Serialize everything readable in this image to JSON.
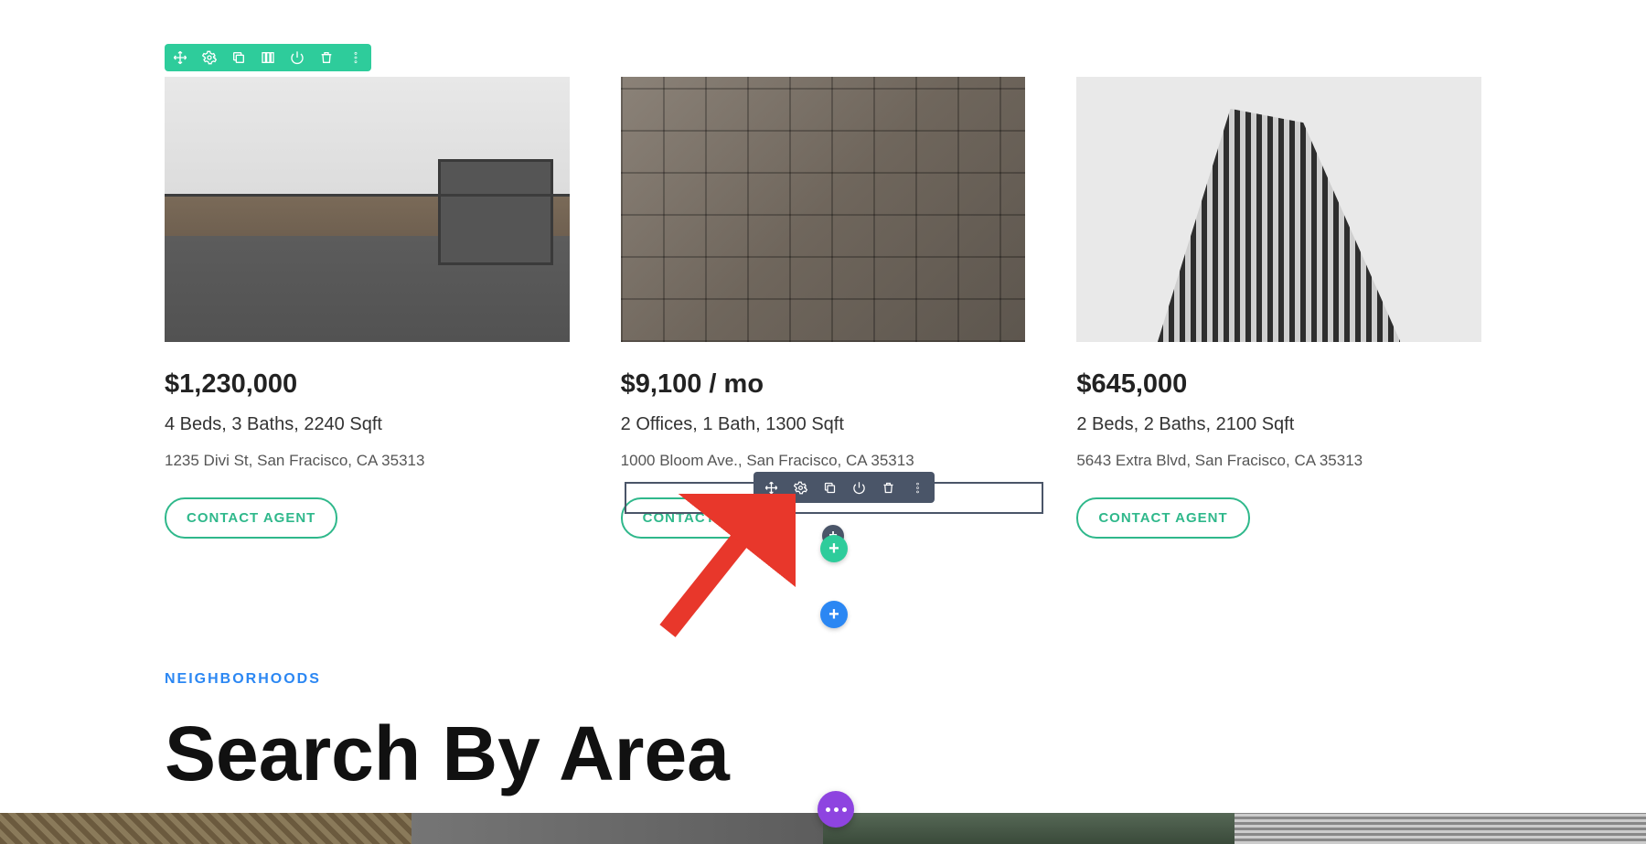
{
  "colors": {
    "accent_teal": "#2ecc9b",
    "accent_blue": "#2b87f3",
    "toolbar_dark": "#4a5568",
    "fab_purple": "#8e44e0"
  },
  "section_toolbar_icons": [
    "move",
    "settings",
    "duplicate",
    "columns",
    "power",
    "delete",
    "more"
  ],
  "module_toolbar_icons": [
    "move",
    "settings",
    "duplicate",
    "power",
    "delete",
    "more"
  ],
  "listings": [
    {
      "price": "$1,230,000",
      "specs": "4 Beds, 3 Baths, 2240 Sqft",
      "address": "1235 Divi St, San Fracisco, CA 35313",
      "button": "CONTACT AGENT"
    },
    {
      "price": "$9,100 / mo",
      "specs": "2 Offices, 1 Bath, 1300 Sqft",
      "address": "1000 Bloom Ave., San Fracisco, CA 35313",
      "button": "CONTACT AGENT"
    },
    {
      "price": "$645,000",
      "specs": "2 Beds, 2 Baths, 2100 Sqft",
      "address": "5643 Extra Blvd, San Fracisco, CA 35313",
      "button": "CONTACT AGENT"
    }
  ],
  "lower": {
    "kicker": "NEIGHBORHOODS",
    "headline": "Search By Area"
  }
}
